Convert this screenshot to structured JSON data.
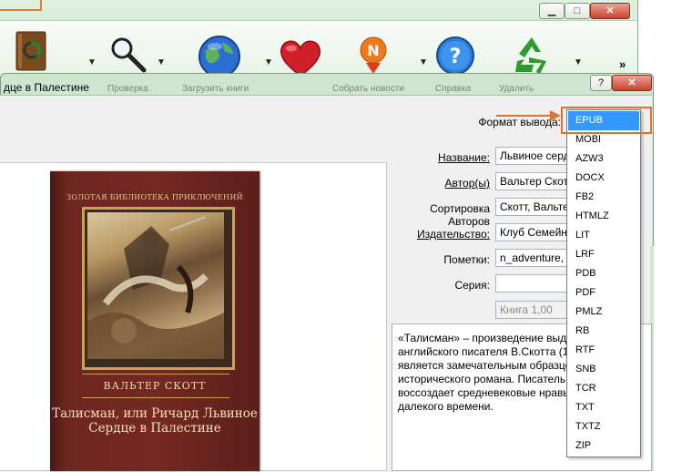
{
  "main_window": {
    "buttons": {
      "minimize": "▁",
      "maximize": "□",
      "close": "✕"
    },
    "toolbar": [
      {
        "icon": "book-convert-icon"
      },
      {
        "icon": "magnifier-icon"
      },
      {
        "icon": "globe-icon"
      },
      {
        "icon": "heart-icon"
      },
      {
        "icon": "news-icon"
      },
      {
        "icon": "help-icon"
      },
      {
        "icon": "recycle-icon"
      }
    ],
    "overflow": "»"
  },
  "dialog": {
    "title": "дце в Палестине",
    "help_btn": "?",
    "close_btn": "✕",
    "strip_labels": [
      "Проверка",
      "Загрузить книги",
      "Собрать новости",
      "Справка",
      "Удалить"
    ],
    "output_format_label": "Формат вывода:",
    "form": {
      "title_label": "Название:",
      "title_value": "Львиное сердце",
      "author_label": "Автор(ы)",
      "author_value": "Вальтер Скотт",
      "sort_label": "Сортировка Авторов",
      "sort_value": "Скотт, Вальтер",
      "publisher_label": "Издательство:",
      "publisher_value": "Клуб Семейного",
      "tags_label": "Пометки:",
      "tags_value": "n_adventure, ac",
      "series_label": "Серия:",
      "series_value": "",
      "book_number": "Книга 1,00"
    },
    "description": "«Талисман» – произведение выдающегося английского писателя В.Скотта (1771–1832) – является замечательным образцом исторического романа. Писатель ярко воссоздает средневековые нравы и обычаи далекого времени.",
    "cover": {
      "series": "ЗОЛОТАЯ БИБЛИОТЕКА ПРИКЛЮЧЕНИЙ",
      "author": "ВАЛЬТЕР СКОТТ",
      "title": "Талисман, или Ричард Львиное Сердце в Палестине"
    },
    "format_dropdown": {
      "selected": "EPUB",
      "options": [
        "EPUB",
        "MOBI",
        "AZW3",
        "DOCX",
        "FB2",
        "HTMLZ",
        "LIT",
        "LRF",
        "PDB",
        "PDF",
        "PMLZ",
        "RB",
        "RTF",
        "SNB",
        "TCR",
        "TXT",
        "TXTZ",
        "ZIP"
      ]
    }
  },
  "colors": {
    "highlight": "#e2702e",
    "selection": "#3399ff",
    "titlebar": "#cfe5cf"
  }
}
